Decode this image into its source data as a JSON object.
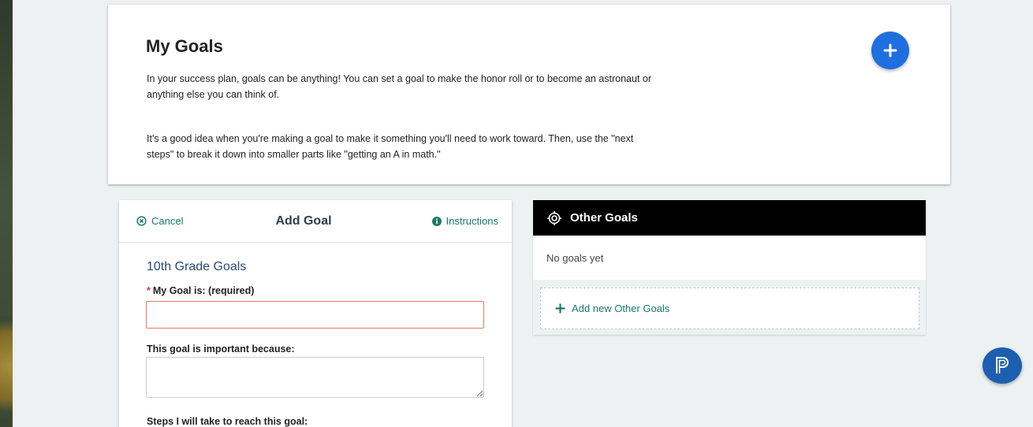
{
  "header": {
    "title": "My Goals",
    "paragraph1": "In your success plan, goals can be anything! You can set a goal to make the honor roll or to become an astronaut or anything else you can think of.",
    "paragraph2": "It's a good idea when you're making a goal to make it something you'll need to work toward. Then, use the \"next steps\" to break it down into smaller parts like \"getting an A in math.\"",
    "add_button_icon": "plus-icon"
  },
  "form": {
    "cancel_label": "Cancel",
    "title": "Add Goal",
    "instructions_label": "Instructions",
    "section_title": "10th Grade Goals",
    "required_marker": "*",
    "goal_label": "My Goal is: (required)",
    "goal_value": "",
    "reason_label": "This goal is important because:",
    "reason_value": "",
    "steps_label": "Steps I will take to reach this goal:"
  },
  "other_goals": {
    "title": "Other Goals",
    "empty_text": "No goals yet",
    "add_label": "Add new Other Goals"
  },
  "colors": {
    "accent_blue": "#1f6fe0",
    "link_teal": "#1a7a6a",
    "error_border": "#e0796e",
    "header_black": "#000000",
    "badge_blue": "#1c5fae"
  }
}
